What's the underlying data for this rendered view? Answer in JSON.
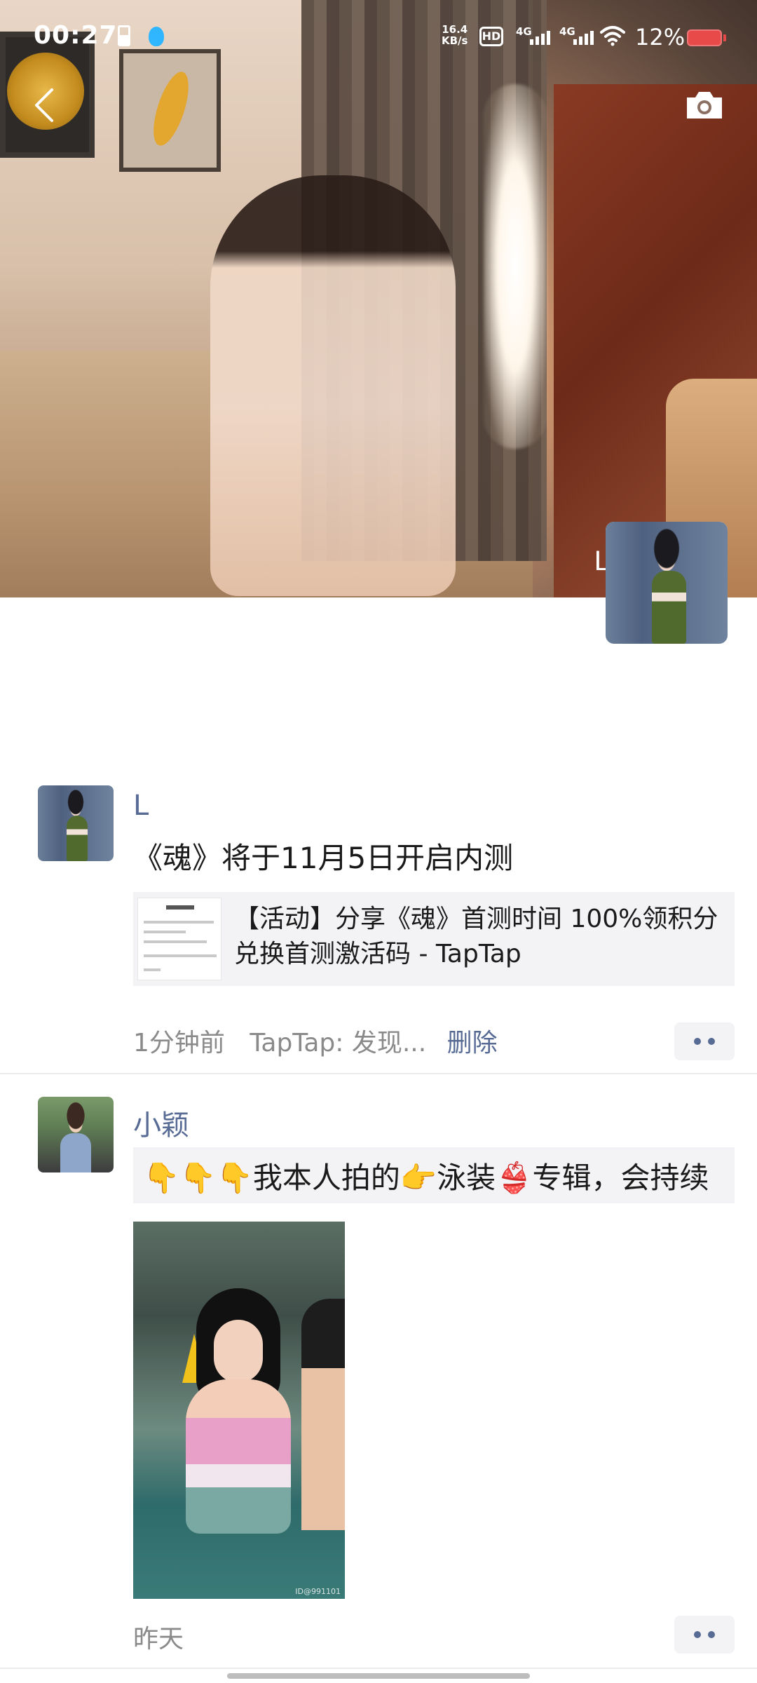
{
  "status_bar": {
    "time": "00:27",
    "net_speed_value": "16.4",
    "net_speed_unit": "KB/s",
    "hd": "HD",
    "sim1": "4G",
    "sim2": "4G",
    "battery_pct": "12%"
  },
  "cover": {
    "owner_name": "L"
  },
  "posts": [
    {
      "user": "L",
      "text": "《魂》将于11月5日开启内测",
      "share_title": "【活动】分享《魂》首测时间 100%领积分兑换首测激活码 - TapTap",
      "time": "1分钟前",
      "source": "TapTap: 发现...",
      "delete_label": "删除"
    },
    {
      "user": "小颖",
      "text": "👇👇👇我本人拍的👉泳装👙专辑，会持续",
      "time": "昨天",
      "image_watermark": "ID@991101"
    }
  ],
  "colors": {
    "link": "#576b95",
    "meta": "#8a8a8a",
    "card_bg": "#f3f3f5"
  }
}
